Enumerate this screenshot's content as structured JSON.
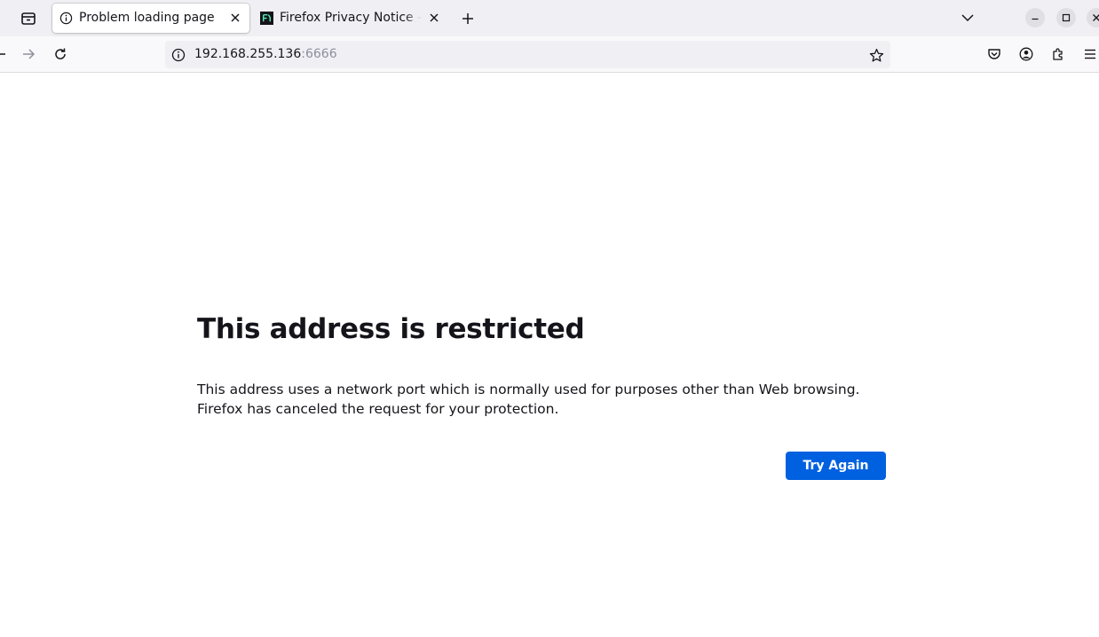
{
  "tabs": [
    {
      "title": "Problem loading page",
      "favicon": "info-icon",
      "active": true
    },
    {
      "title": "Firefox Privacy Notice — Mozilla",
      "favicon": "mozilla-logo-icon",
      "active": false
    }
  ],
  "urlbar": {
    "host": "192.168.255.136",
    "port": ":6666"
  },
  "error": {
    "title": "This address is restricted",
    "line1": "This address uses a network port which is normally used for purposes other than Web browsing.",
    "line2": "Firefox has canceled the request for your protection.",
    "button_label": "Try Again"
  },
  "colors": {
    "accent": "#0061e0",
    "tabstrip": "#f0f0f4",
    "toolbar": "#f9f9fb"
  },
  "icons": [
    "tab-list-icon",
    "info-icon",
    "close-icon",
    "mozilla-logo-icon",
    "plus-icon",
    "chevron-down-icon",
    "minimize-icon",
    "maximize-icon",
    "window-close-icon",
    "back-arrow-icon",
    "forward-arrow-icon",
    "reload-icon",
    "star-icon",
    "pocket-icon",
    "account-icon",
    "extensions-icon",
    "hamburger-menu-icon"
  ]
}
